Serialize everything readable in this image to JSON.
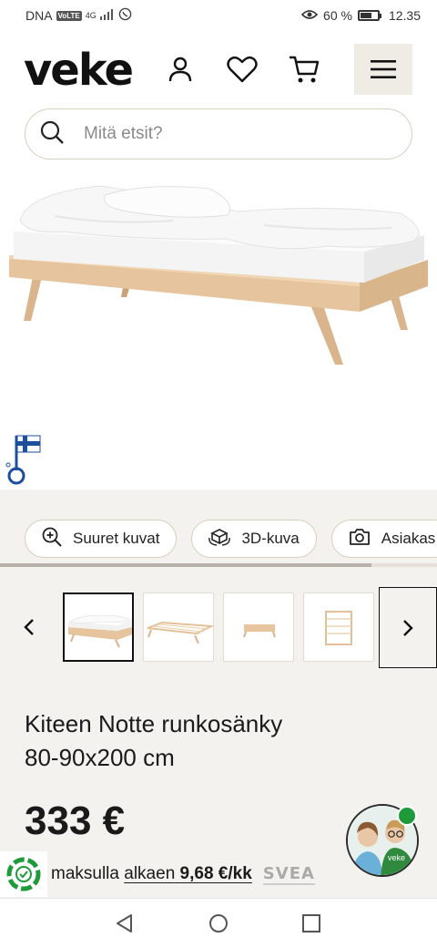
{
  "status_bar": {
    "carrier": "DNA",
    "volte": "VoLTE",
    "network": "4G",
    "battery_percent": "60 %",
    "battery_level": 0.6,
    "time": "12.35"
  },
  "header": {
    "logo": "veke",
    "search_placeholder": "Mitä etsit?"
  },
  "media_buttons": [
    {
      "label": "Suuret kuvat",
      "icon": "zoom-in-icon"
    },
    {
      "label": "3D-kuva",
      "icon": "rotate-3d-icon"
    },
    {
      "label": "Asiakas",
      "icon": "camera-icon"
    }
  ],
  "gallery": {
    "scroll_progress": 0.85,
    "selected_index": 0,
    "thumb_count": 4
  },
  "product": {
    "title_line1": "Kiteen Notte runkosänky",
    "title_line2": "80-90x200 cm",
    "price": "333 €"
  },
  "financing": {
    "prefix": "maksulla",
    "offer": "alkaen",
    "amount": "9,68 €/kk",
    "provider": "SVEA"
  },
  "chat": {
    "shirt_text": "veke"
  },
  "colors": {
    "accent_green": "#1f9a3a",
    "page_bg": "#f4f2ee",
    "chip_border": "#d9cfbd"
  }
}
